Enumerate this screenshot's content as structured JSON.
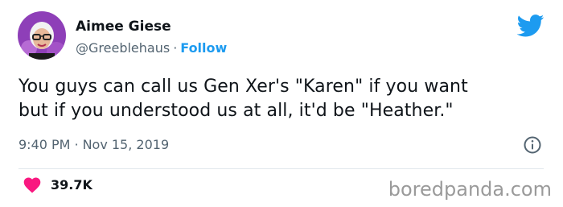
{
  "user": {
    "display_name": "Aimee Giese",
    "handle": "@Greeblehaus",
    "separator": "·",
    "follow_label": "Follow"
  },
  "tweet": {
    "text_lines": [
      "You guys can call us Gen Xer's \"Karen\" if you want",
      "but if you understood us at all, it'd be \"Heather.\""
    ],
    "time": "9:40 PM",
    "separator": "·",
    "date": "Nov 15, 2019"
  },
  "engagement": {
    "likes": "39.7K"
  },
  "watermark": "boredpanda.com",
  "icons": {
    "brand": "twitter-bird-icon",
    "info": "info-icon",
    "like": "heart-icon"
  },
  "colors": {
    "link_blue": "#1d9bf0",
    "twitter_blue": "#1d9bf0",
    "heart_pink": "#f91880",
    "secondary_text": "#536471",
    "primary_text": "#0f1419"
  }
}
